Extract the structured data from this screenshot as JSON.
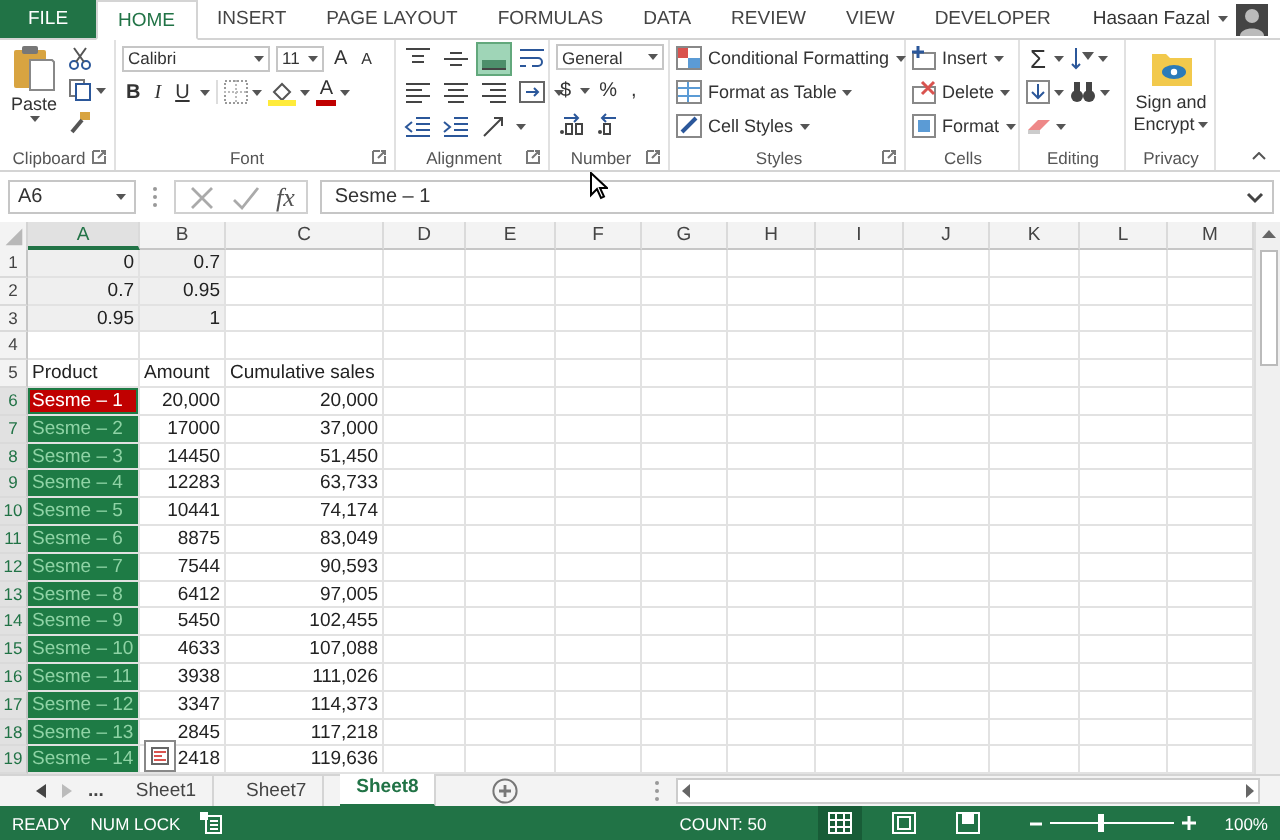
{
  "tabs": [
    {
      "label": "FILE",
      "kind": "file",
      "selected": false
    },
    {
      "label": "HOME",
      "kind": "tab",
      "selected": true
    },
    {
      "label": "INSERT",
      "kind": "tab",
      "selected": false
    },
    {
      "label": "PAGE LAYOUT",
      "kind": "tab",
      "selected": false
    },
    {
      "label": "FORMULAS",
      "kind": "tab",
      "selected": false
    },
    {
      "label": "DATA",
      "kind": "tab",
      "selected": false
    },
    {
      "label": "REVIEW",
      "kind": "tab",
      "selected": false
    },
    {
      "label": "VIEW",
      "kind": "tab",
      "selected": false
    },
    {
      "label": "DEVELOPER",
      "kind": "tab",
      "selected": false
    }
  ],
  "user": {
    "name": "Hasaan Fazal"
  },
  "ribbon": {
    "clipboard": {
      "label": "Clipboard",
      "paste": "Paste"
    },
    "font": {
      "label": "Font",
      "name": "Calibri",
      "size": "11",
      "grow": "A",
      "shrink": "A",
      "styles": [
        "B",
        "I",
        "U"
      ],
      "font_color": "A"
    },
    "alignment": {
      "label": "Alignment",
      "buttons": [
        {
          "kind": "top",
          "selected": false
        },
        {
          "kind": "middle",
          "selected": false
        },
        {
          "kind": "bottom",
          "selected": true
        },
        {
          "kind": "wrap",
          "selected": false
        },
        {
          "kind": "left",
          "selected": false
        },
        {
          "kind": "center",
          "selected": false
        },
        {
          "kind": "right",
          "selected": false
        },
        {
          "kind": "merge",
          "selected": false
        },
        {
          "kind": "outdent",
          "selected": false
        },
        {
          "kind": "indent",
          "selected": false
        },
        {
          "kind": "orientation",
          "selected": false
        }
      ]
    },
    "number": {
      "label": "Number",
      "format": "General",
      "currency": "$",
      "percent": "%",
      "comma": ","
    },
    "styles": {
      "label": "Styles",
      "buttons": [
        "Conditional Formatting",
        "Format as Table",
        "Cell Styles"
      ]
    },
    "cells": {
      "label": "Cells",
      "buttons": [
        "Insert",
        "Delete",
        "Format"
      ]
    },
    "editing": {
      "label": "Editing",
      "sum": "Σ"
    },
    "privacy": {
      "label": "Privacy",
      "button": "Sign and Encrypt"
    }
  },
  "formula_bar": {
    "name_box": "A6",
    "function_label": "fx",
    "formula": "Sesme – 1"
  },
  "sheet": {
    "columns": [
      {
        "label": "A",
        "selected": true
      },
      {
        "label": "B",
        "selected": false
      },
      {
        "label": "C",
        "selected": false
      },
      {
        "label": "D",
        "selected": false
      },
      {
        "label": "E",
        "selected": false
      },
      {
        "label": "F",
        "selected": false
      },
      {
        "label": "G",
        "selected": false
      },
      {
        "label": "H",
        "selected": false
      },
      {
        "label": "I",
        "selected": false
      },
      {
        "label": "J",
        "selected": false
      },
      {
        "label": "K",
        "selected": false
      },
      {
        "label": "L",
        "selected": false
      },
      {
        "label": "M",
        "selected": false
      }
    ],
    "rows": [
      {
        "label": "1",
        "selected": false,
        "cells": [
          {
            "text": "0",
            "kind": "number",
            "shaded": true,
            "selected": false,
            "active": false
          },
          {
            "text": "0.7",
            "kind": "number",
            "shaded": true,
            "selected": false,
            "active": false
          },
          null
        ]
      },
      {
        "label": "2",
        "selected": false,
        "cells": [
          {
            "text": "0.7",
            "kind": "number",
            "shaded": true,
            "selected": false,
            "active": false
          },
          {
            "text": "0.95",
            "kind": "number",
            "shaded": true,
            "selected": false,
            "active": false
          },
          null
        ]
      },
      {
        "label": "3",
        "selected": false,
        "cells": [
          {
            "text": "0.95",
            "kind": "number",
            "shaded": true,
            "selected": false,
            "active": false
          },
          {
            "text": "1",
            "kind": "number",
            "shaded": true,
            "selected": false,
            "active": false
          },
          null
        ]
      },
      {
        "label": "4",
        "selected": false,
        "cells": [
          null,
          null,
          null
        ]
      },
      {
        "label": "5",
        "selected": false,
        "cells": [
          {
            "text": "Product",
            "kind": "text",
            "shaded": false,
            "selected": false,
            "active": false
          },
          {
            "text": "Amount",
            "kind": "text",
            "shaded": false,
            "selected": false,
            "active": false
          },
          {
            "text": "Cumulative sales",
            "kind": "text",
            "shaded": false,
            "selected": false,
            "active": false
          }
        ]
      },
      {
        "label": "6",
        "selected": true,
        "cells": [
          {
            "text": "Sesme – 1",
            "kind": "text",
            "shaded": false,
            "selected": true,
            "active": true
          },
          {
            "text": "20,000",
            "kind": "number",
            "shaded": false,
            "selected": false,
            "active": false
          },
          {
            "text": "20,000",
            "kind": "number",
            "shaded": false,
            "selected": false,
            "active": false
          }
        ]
      },
      {
        "label": "7",
        "selected": true,
        "cells": [
          {
            "text": "Sesme – 2",
            "kind": "text",
            "shaded": false,
            "selected": true,
            "active": false
          },
          {
            "text": "17000",
            "kind": "number",
            "shaded": false,
            "selected": false,
            "active": false
          },
          {
            "text": "37,000",
            "kind": "number",
            "shaded": false,
            "selected": false,
            "active": false
          }
        ]
      },
      {
        "label": "8",
        "selected": true,
        "cells": [
          {
            "text": "Sesme – 3",
            "kind": "text",
            "shaded": false,
            "selected": true,
            "active": false
          },
          {
            "text": "14450",
            "kind": "number",
            "shaded": false,
            "selected": false,
            "active": false
          },
          {
            "text": "51,450",
            "kind": "number",
            "shaded": false,
            "selected": false,
            "active": false
          }
        ]
      },
      {
        "label": "9",
        "selected": true,
        "cells": [
          {
            "text": "Sesme – 4",
            "kind": "text",
            "shaded": false,
            "selected": true,
            "active": false
          },
          {
            "text": "12283",
            "kind": "number",
            "shaded": false,
            "selected": false,
            "active": false
          },
          {
            "text": "63,733",
            "kind": "number",
            "shaded": false,
            "selected": false,
            "active": false
          }
        ]
      },
      {
        "label": "10",
        "selected": true,
        "cells": [
          {
            "text": "Sesme – 5",
            "kind": "text",
            "shaded": false,
            "selected": true,
            "active": false
          },
          {
            "text": "10441",
            "kind": "number",
            "shaded": false,
            "selected": false,
            "active": false
          },
          {
            "text": "74,174",
            "kind": "number",
            "shaded": false,
            "selected": false,
            "active": false
          }
        ]
      },
      {
        "label": "11",
        "selected": true,
        "cells": [
          {
            "text": "Sesme – 6",
            "kind": "text",
            "shaded": false,
            "selected": true,
            "active": false
          },
          {
            "text": "8875",
            "kind": "number",
            "shaded": false,
            "selected": false,
            "active": false
          },
          {
            "text": "83,049",
            "kind": "number",
            "shaded": false,
            "selected": false,
            "active": false
          }
        ]
      },
      {
        "label": "12",
        "selected": true,
        "cells": [
          {
            "text": "Sesme – 7",
            "kind": "text",
            "shaded": false,
            "selected": true,
            "active": false
          },
          {
            "text": "7544",
            "kind": "number",
            "shaded": false,
            "selected": false,
            "active": false
          },
          {
            "text": "90,593",
            "kind": "number",
            "shaded": false,
            "selected": false,
            "active": false
          }
        ]
      },
      {
        "label": "13",
        "selected": true,
        "cells": [
          {
            "text": "Sesme – 8",
            "kind": "text",
            "shaded": false,
            "selected": true,
            "active": false
          },
          {
            "text": "6412",
            "kind": "number",
            "shaded": false,
            "selected": false,
            "active": false
          },
          {
            "text": "97,005",
            "kind": "number",
            "shaded": false,
            "selected": false,
            "active": false
          }
        ]
      },
      {
        "label": "14",
        "selected": true,
        "cells": [
          {
            "text": "Sesme – 9",
            "kind": "text",
            "shaded": false,
            "selected": true,
            "active": false
          },
          {
            "text": "5450",
            "kind": "number",
            "shaded": false,
            "selected": false,
            "active": false
          },
          {
            "text": "102,455",
            "kind": "number",
            "shaded": false,
            "selected": false,
            "active": false
          }
        ]
      },
      {
        "label": "15",
        "selected": true,
        "cells": [
          {
            "text": "Sesme – 10",
            "kind": "text",
            "shaded": false,
            "selected": true,
            "active": false
          },
          {
            "text": "4633",
            "kind": "number",
            "shaded": false,
            "selected": false,
            "active": false
          },
          {
            "text": "107,088",
            "kind": "number",
            "shaded": false,
            "selected": false,
            "active": false
          }
        ]
      },
      {
        "label": "16",
        "selected": true,
        "cells": [
          {
            "text": "Sesme – 11",
            "kind": "text",
            "shaded": false,
            "selected": true,
            "active": false
          },
          {
            "text": "3938",
            "kind": "number",
            "shaded": false,
            "selected": false,
            "active": false
          },
          {
            "text": "111,026",
            "kind": "number",
            "shaded": false,
            "selected": false,
            "active": false
          }
        ]
      },
      {
        "label": "17",
        "selected": true,
        "cells": [
          {
            "text": "Sesme – 12",
            "kind": "text",
            "shaded": false,
            "selected": true,
            "active": false
          },
          {
            "text": "3347",
            "kind": "number",
            "shaded": false,
            "selected": false,
            "active": false
          },
          {
            "text": "114,373",
            "kind": "number",
            "shaded": false,
            "selected": false,
            "active": false
          }
        ]
      },
      {
        "label": "18",
        "selected": true,
        "cells": [
          {
            "text": "Sesme – 13",
            "kind": "text",
            "shaded": false,
            "selected": true,
            "active": false
          },
          {
            "text": "2845",
            "kind": "number",
            "shaded": false,
            "selected": false,
            "active": false
          },
          {
            "text": "117,218",
            "kind": "number",
            "shaded": false,
            "selected": false,
            "active": false
          }
        ]
      },
      {
        "label": "19",
        "selected": true,
        "cells": [
          {
            "text": "Sesme – 14",
            "kind": "text",
            "shaded": false,
            "selected": true,
            "active": false
          },
          {
            "text": "2418",
            "kind": "number",
            "shaded": false,
            "selected": false,
            "active": false
          },
          {
            "text": "119,636",
            "kind": "number",
            "shaded": false,
            "selected": false,
            "active": false
          }
        ]
      }
    ]
  },
  "sheet_tabs": {
    "overflow": "...",
    "tabs": [
      {
        "label": "Sheet1",
        "selected": false
      },
      {
        "label": "Sheet7",
        "selected": false
      },
      {
        "label": "Sheet8",
        "selected": true
      }
    ]
  },
  "status_bar": {
    "mode": "READY",
    "num_lock": "NUM LOCK",
    "count": "COUNT: 50",
    "views": [
      {
        "kind": "normal",
        "selected": true
      },
      {
        "kind": "page_layout",
        "selected": false
      },
      {
        "kind": "page_break",
        "selected": false
      }
    ],
    "zoom": {
      "level": 0.4,
      "reading": "100%"
    }
  }
}
